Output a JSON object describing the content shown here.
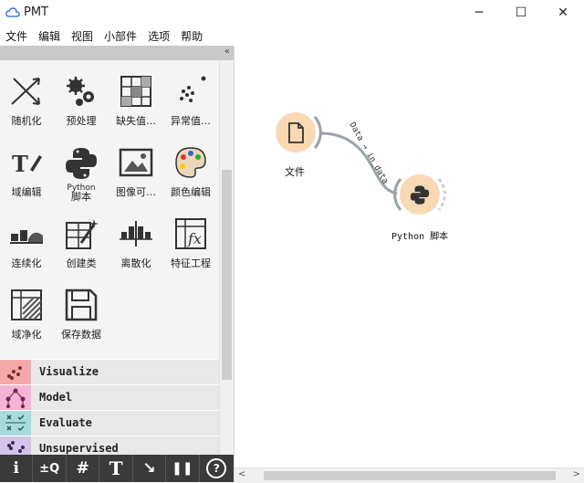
{
  "window": {
    "title": "PMT",
    "minimize": "─",
    "maximize": "☐",
    "close": "✕"
  },
  "menu": [
    "文件",
    "编辑",
    "视图",
    "小部件",
    "选项",
    "帮助"
  ],
  "panel": {
    "collapse_label": "«"
  },
  "widgets": [
    {
      "label": "随机化",
      "icon": "randomize-icon"
    },
    {
      "label": "预处理",
      "icon": "gears-icon"
    },
    {
      "label": "缺失值…",
      "icon": "grid-icon"
    },
    {
      "label": "异常值…",
      "icon": "scatter-dots-icon"
    },
    {
      "label": "域编辑",
      "icon": "text-edit-icon"
    },
    {
      "label_line1": "Python",
      "label_line2": "脚本",
      "icon": "python-icon"
    },
    {
      "label": "图像可…",
      "icon": "image-icon"
    },
    {
      "label": "颜色编辑",
      "icon": "palette-icon"
    },
    {
      "label": "连续化",
      "icon": "continuize-icon"
    },
    {
      "label": "创建类",
      "icon": "magic-wand-icon"
    },
    {
      "label": "离散化",
      "icon": "discretize-icon"
    },
    {
      "label": "特征工程",
      "icon": "formula-icon"
    },
    {
      "label": "域净化",
      "icon": "purge-domain-icon"
    },
    {
      "label": "保存数据",
      "icon": "floppy-disk-icon"
    }
  ],
  "categories": [
    {
      "label": "Visualize",
      "color": "#f4a9a9"
    },
    {
      "label": "Model",
      "color": "#f6b4d4"
    },
    {
      "label": "Evaluate",
      "color": "#a8dcdc"
    },
    {
      "label": "Unsupervised",
      "color": "#d4c4e8"
    }
  ],
  "toolbar": [
    {
      "label": "i",
      "icon": "info-icon"
    },
    {
      "label": "±Q",
      "icon": "zoom-icon"
    },
    {
      "label": "#",
      "icon": "grid-align-icon"
    },
    {
      "label": "T",
      "icon": "text-annotation-icon"
    },
    {
      "label": "↘",
      "icon": "arrow-annotation-icon"
    },
    {
      "label": "❚❚",
      "icon": "pause-icon"
    },
    {
      "label": "?",
      "icon": "help-icon"
    }
  ],
  "canvas": {
    "nodes": [
      {
        "label": "文件",
        "icon": "file-icon"
      },
      {
        "label": "Python 脚本",
        "icon": "python-icon"
      }
    ],
    "link": {
      "label": "Data → in_data"
    },
    "colors": {
      "node_fill": "#f8d9b4",
      "link": "#9aa3a8"
    }
  },
  "scroll": {
    "left_arrow": "<",
    "right_arrow": ">"
  }
}
